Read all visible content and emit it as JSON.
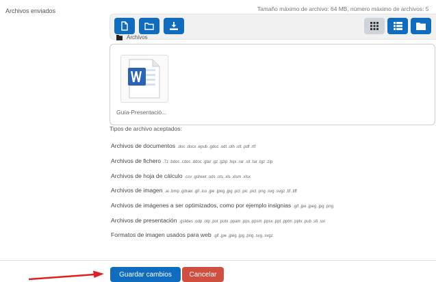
{
  "field_label": "Archivos enviados",
  "limits_text": "Tamaño máximo de archivo: 64 MB, número máximo de archivos: 5",
  "toolbar": {
    "buttons": [
      {
        "name": "add-file-icon"
      },
      {
        "name": "create-folder-icon"
      },
      {
        "name": "download-icon"
      },
      {
        "name": "grid-view-icon"
      },
      {
        "name": "list-view-icon"
      },
      {
        "name": "tree-view-icon"
      }
    ]
  },
  "breadcrumb": "Archivos",
  "file": {
    "name": "Guía-Presentació..."
  },
  "types_heading": "Tipos de archivo aceptados:",
  "file_types": [
    {
      "label": "Archivos de documentos",
      "ext": ".doc .docx .epub .gdoc .odt .oth .ott .pdf .rtf"
    },
    {
      "label": "Archivos de fichero",
      "ext": ".7z .bdoc .cdoc .ddoc .gtar .gz .gzip .hqx .rar .sit .tar .tgz .zip"
    },
    {
      "label": "Archivos de hoja de cálculo",
      "ext": ".csv .gsheet .ods .ots .xls .xlsm .xlsx"
    },
    {
      "label": "Archivos de imagen",
      "ext": ".ai .bmp .gdraw .gif .ico .jpe .jpeg .jpg .pct .pic .pict .png .svg .svgz .tif .tiff"
    },
    {
      "label": "Archivos de imágenes a ser optimizados, como por ejemplo insignias",
      "ext": ".gif .jpe .jpeg .jpg .png"
    },
    {
      "label": "Archivos de presentación",
      "ext": ".gslides .odp .otp .pot .potx .ppam .pps .ppsm .ppsx .ppt .pptm .pptx .pub .sti .sxi"
    },
    {
      "label": "Formatos de imagen usados para web",
      "ext": ".gif .jpe .jpeg .jpg .png .svg .svgz"
    }
  ],
  "actions": {
    "save": "Guardar cambios",
    "cancel": "Cancelar"
  },
  "colors": {
    "primary": "#0f6cbf",
    "danger": "#ca3120",
    "arrow": "#e02020"
  }
}
